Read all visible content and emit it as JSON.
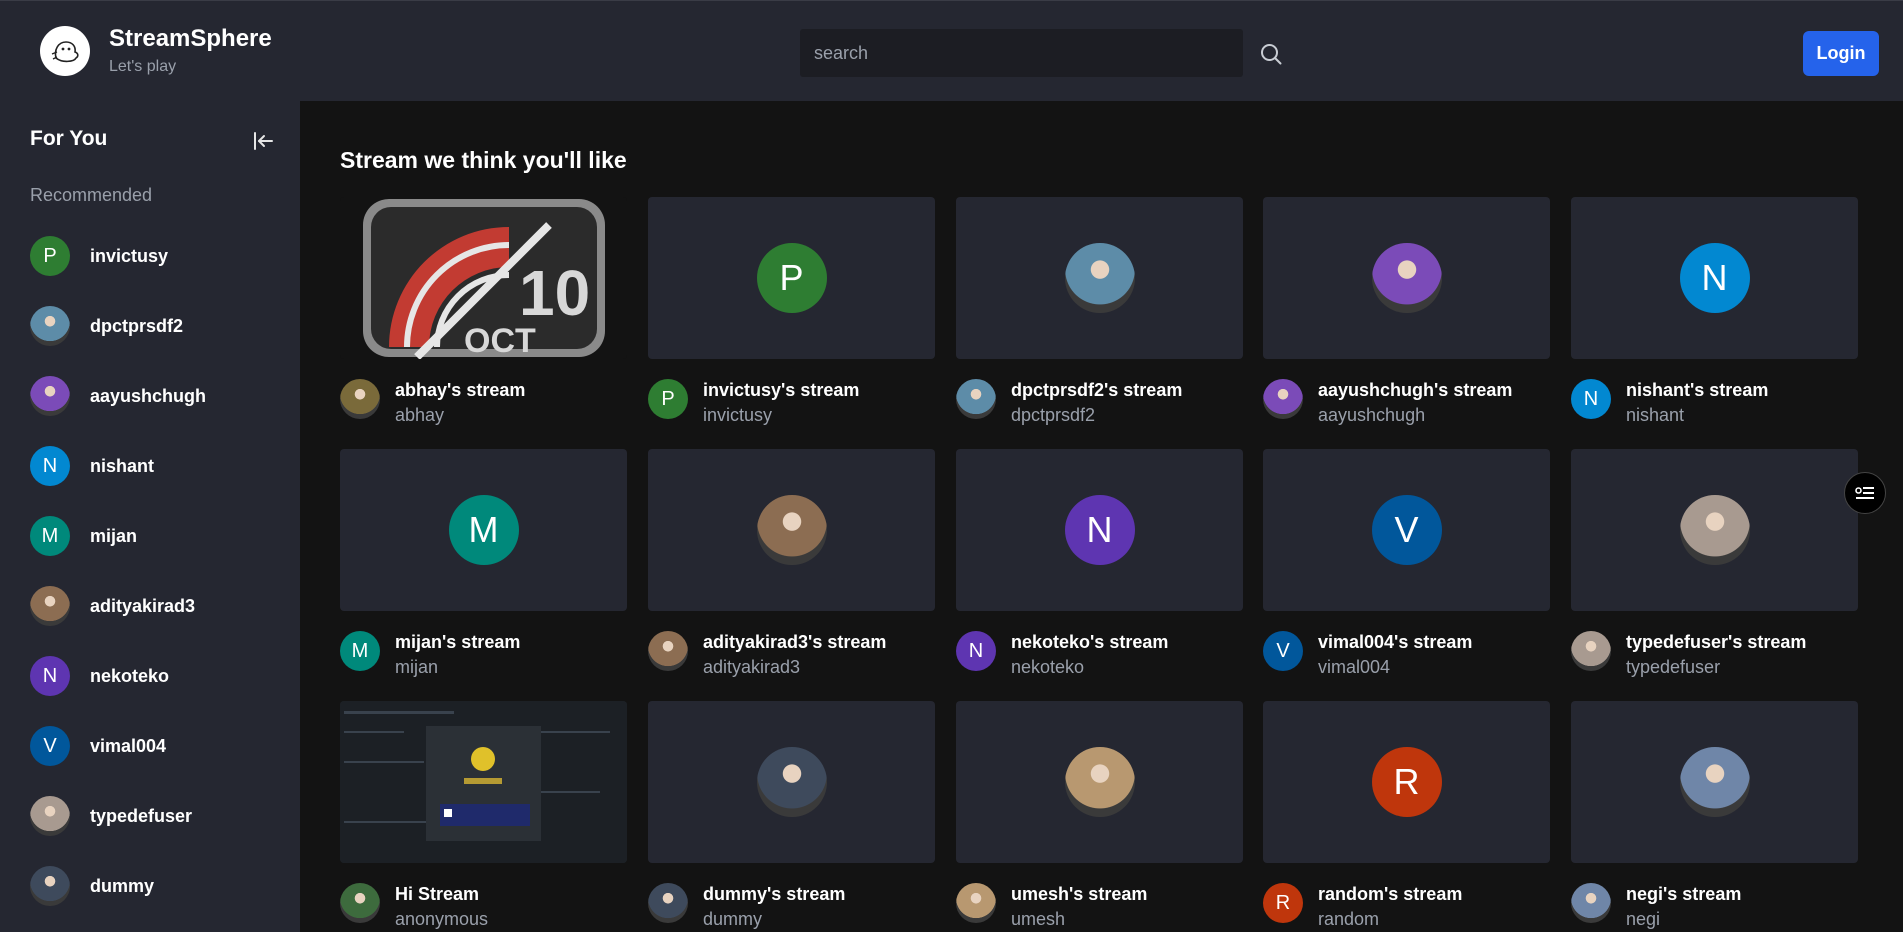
{
  "brand": {
    "name": "StreamSphere",
    "tagline": "Let's play",
    "logo_icon": "ghost-logo-icon"
  },
  "search": {
    "placeholder": "search"
  },
  "header": {
    "login_label": "Login"
  },
  "sidebar": {
    "title": "For You",
    "section_label": "Recommended",
    "items": [
      {
        "label": "invictusy",
        "avatar": {
          "kind": "letter",
          "letter": "P",
          "color": "#2e7d32"
        }
      },
      {
        "label": "dpctprsdf2",
        "avatar": {
          "kind": "photo",
          "color": "#5d8ca8"
        }
      },
      {
        "label": "aayushchugh",
        "avatar": {
          "kind": "photo",
          "color": "#7b4bb8"
        }
      },
      {
        "label": "nishant",
        "avatar": {
          "kind": "letter",
          "letter": "N",
          "color": "#0288d1"
        }
      },
      {
        "label": "mijan",
        "avatar": {
          "kind": "letter",
          "letter": "M",
          "color": "#00897b"
        }
      },
      {
        "label": "adityakirad3",
        "avatar": {
          "kind": "photo",
          "color": "#8c6d52"
        }
      },
      {
        "label": "nekoteko",
        "avatar": {
          "kind": "letter",
          "letter": "N",
          "color": "#5e35b1"
        }
      },
      {
        "label": "vimal004",
        "avatar": {
          "kind": "letter",
          "letter": "V",
          "color": "#01579b"
        }
      },
      {
        "label": "typedefuser",
        "avatar": {
          "kind": "photo",
          "color": "#a89a90"
        }
      },
      {
        "label": "dummy",
        "avatar": {
          "kind": "photo",
          "color": "#3e4a5c"
        }
      }
    ]
  },
  "main": {
    "title": "Stream we think you'll like",
    "streams": [
      {
        "title": "abhay's stream",
        "user": "abhay",
        "thumb": "oct10",
        "avatar": {
          "kind": "photo",
          "color": "#7a6a3a"
        }
      },
      {
        "title": "invictusy's stream",
        "user": "invictusy",
        "thumb": "avatar",
        "avatar": {
          "kind": "letter",
          "letter": "P",
          "color": "#2e7d32"
        }
      },
      {
        "title": "dpctprsdf2's stream",
        "user": "dpctprsdf2",
        "thumb": "avatar",
        "avatar": {
          "kind": "photo",
          "color": "#5d8ca8"
        }
      },
      {
        "title": "aayushchugh's stream",
        "user": "aayushchugh",
        "thumb": "avatar",
        "avatar": {
          "kind": "photo",
          "color": "#7b4bb8"
        }
      },
      {
        "title": "nishant's stream",
        "user": "nishant",
        "thumb": "avatar",
        "avatar": {
          "kind": "letter",
          "letter": "N",
          "color": "#0288d1"
        }
      },
      {
        "title": "mijan's stream",
        "user": "mijan",
        "thumb": "avatar",
        "avatar": {
          "kind": "letter",
          "letter": "M",
          "color": "#00897b"
        }
      },
      {
        "title": "adityakirad3's stream",
        "user": "adityakirad3",
        "thumb": "avatar",
        "avatar": {
          "kind": "photo",
          "color": "#8c6d52"
        }
      },
      {
        "title": "nekoteko's stream",
        "user": "nekoteko",
        "thumb": "avatar",
        "avatar": {
          "kind": "letter",
          "letter": "N",
          "color": "#5e35b1"
        }
      },
      {
        "title": "vimal004's stream",
        "user": "vimal004",
        "thumb": "avatar",
        "avatar": {
          "kind": "letter",
          "letter": "V",
          "color": "#01579b"
        }
      },
      {
        "title": "typedefuser's stream",
        "user": "typedefuser",
        "thumb": "avatar",
        "avatar": {
          "kind": "photo",
          "color": "#a89a90"
        }
      },
      {
        "title": "Hi Stream",
        "user": "anonymous",
        "thumb": "screen",
        "avatar": {
          "kind": "photo",
          "color": "#3d6b3d"
        }
      },
      {
        "title": "dummy's stream",
        "user": "dummy",
        "thumb": "avatar",
        "avatar": {
          "kind": "photo",
          "color": "#3e4a5c"
        }
      },
      {
        "title": "umesh's stream",
        "user": "umesh",
        "thumb": "avatar",
        "avatar": {
          "kind": "photo",
          "color": "#b89870"
        }
      },
      {
        "title": "random's stream",
        "user": "random",
        "thumb": "avatar",
        "avatar": {
          "kind": "letter",
          "letter": "R",
          "color": "#bf360c"
        }
      },
      {
        "title": "negi's stream",
        "user": "negi",
        "thumb": "avatar",
        "avatar": {
          "kind": "photo",
          "color": "#6f86a8"
        }
      }
    ]
  },
  "colors": {
    "accent": "#2563eb",
    "header_bg": "#252731",
    "page_bg": "#131313",
    "card_bg": "#252731",
    "muted_text": "#9aa0ab"
  }
}
